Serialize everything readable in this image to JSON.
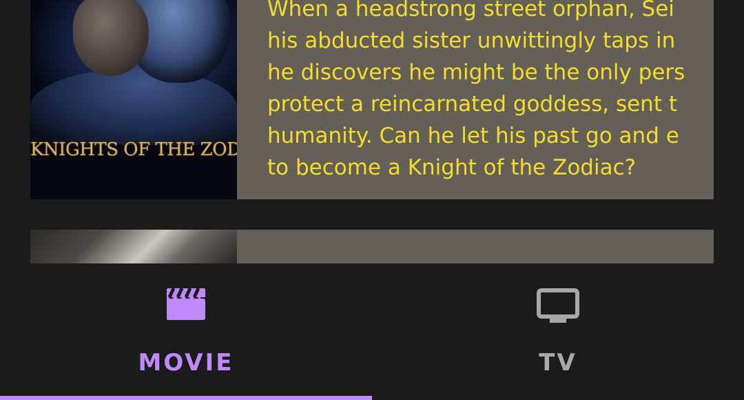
{
  "colors": {
    "background": "#1c1b1b",
    "card": "#646057",
    "description_text": "#f5dc2d",
    "active_tab": "#c08aff",
    "inactive_tab": "#a8a8a8"
  },
  "movies": [
    {
      "poster_title": "KNIGHTS OF THE ZODIAC",
      "description_lines": [
        "When a headstrong street orphan, Sei",
        "his abducted sister unwittingly taps in",
        "he discovers he might be the only pers",
        "protect a reincarnated goddess, sent t",
        "humanity. Can he let his past go and e",
        "to become a Knight of the Zodiac?"
      ]
    },
    {
      "poster_title": "",
      "description_lines": []
    }
  ],
  "bottom_nav": {
    "tabs": [
      {
        "label": "MOVIE",
        "icon": "clapperboard-icon",
        "active": true
      },
      {
        "label": "TV",
        "icon": "tv-icon",
        "active": false
      }
    ]
  }
}
